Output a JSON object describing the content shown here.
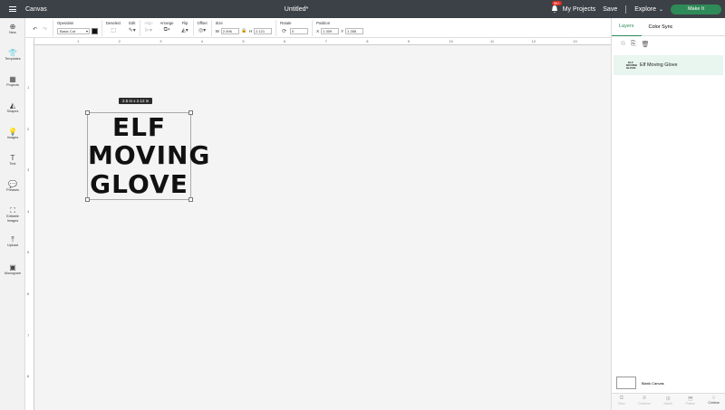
{
  "header": {
    "app": "Canvas",
    "doc_title": "Untitled*",
    "notif_count": "99+",
    "my_projects": "My Projects",
    "save": "Save",
    "explore": "Explore",
    "make_it": "Make It"
  },
  "toolbar": {
    "operation_label": "Operation",
    "operation_value": "Basic Cut",
    "deselect": "Deselect",
    "edit": "Edit",
    "align": "Align",
    "arrange": "Arrange",
    "flip": "Flip",
    "offset": "Offset",
    "size_label": "Size",
    "w_label": "W",
    "w_value": "2.496",
    "h_label": "H",
    "h_value": "2.121",
    "rotate_label": "Rotate",
    "rotate_value": "0",
    "position_label": "Position",
    "x_label": "X",
    "x_value": "1.309",
    "y_label": "Y",
    "y_value": "1.356"
  },
  "sidebar": {
    "items": [
      {
        "label": "New"
      },
      {
        "label": "Templates"
      },
      {
        "label": "Projects"
      },
      {
        "label": "Shapes"
      },
      {
        "label": "Images"
      },
      {
        "label": "Text"
      },
      {
        "label": "Phrases"
      },
      {
        "label": "Editable Images"
      },
      {
        "label": "Upload"
      },
      {
        "label": "Monogram"
      }
    ]
  },
  "ruler": {
    "h": [
      "1",
      "2",
      "3",
      "4",
      "5",
      "6",
      "7",
      "8",
      "9",
      "10",
      "11",
      "12",
      "13"
    ],
    "v": [
      "1",
      "2",
      "3",
      "4",
      "5",
      "6",
      "7",
      "8"
    ]
  },
  "design": {
    "lines": [
      "ELF",
      "MOVING",
      "GLOVE"
    ],
    "dimensions": "2.5  in x 2.12  in"
  },
  "layers": {
    "tab_layers": "Layers",
    "tab_color_sync": "Color Sync",
    "item": "Elf Moving Glove",
    "thumb": [
      "ELF",
      "MOVING",
      "GLOVE"
    ],
    "blank_canvas": "Blank Canvas",
    "bottom": [
      "Slice",
      "Combine",
      "Attach",
      "Flatten",
      "Contour"
    ]
  }
}
